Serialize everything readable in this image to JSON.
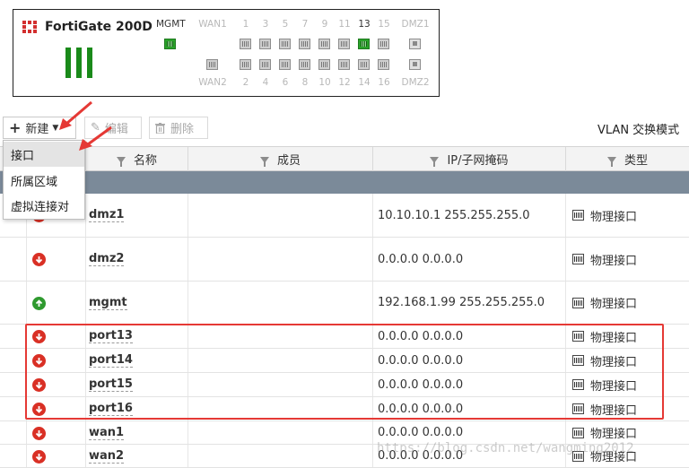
{
  "device": {
    "model": "FortiGate 200D",
    "top_labels": [
      "MGMT",
      "WAN1",
      "1",
      "3",
      "5",
      "7",
      "9",
      "11",
      "13",
      "15",
      "DMZ1"
    ],
    "bottom_labels": [
      "WAN2",
      "2",
      "4",
      "6",
      "8",
      "10",
      "12",
      "14",
      "16",
      "DMZ2"
    ],
    "active_labels": [
      "MGMT",
      "13"
    ]
  },
  "toolbar": {
    "create_label": "新建",
    "edit_label": "编辑",
    "delete_label": "删除",
    "vlan_mode_label": "VLAN 交换模式"
  },
  "create_menu": {
    "items": [
      "接口",
      "所属区域",
      "虚拟连接对"
    ]
  },
  "table": {
    "columns": [
      "名称",
      "成员",
      "IP/子网掩码",
      "类型"
    ],
    "rows": [
      {
        "name": "dmz1",
        "status": "down",
        "members": "",
        "ip": "10.10.10.1 255.255.255.0",
        "type": "物理接口"
      },
      {
        "name": "dmz2",
        "status": "down",
        "members": "",
        "ip": "0.0.0.0 0.0.0.0",
        "type": "物理接口"
      },
      {
        "name": "mgmt",
        "status": "up",
        "members": "",
        "ip": "192.168.1.99 255.255.255.0",
        "type": "物理接口"
      },
      {
        "name": "port13",
        "status": "down",
        "members": "",
        "ip": "0.0.0.0 0.0.0.0",
        "type": "物理接口"
      },
      {
        "name": "port14",
        "status": "down",
        "members": "",
        "ip": "0.0.0.0 0.0.0.0",
        "type": "物理接口"
      },
      {
        "name": "port15",
        "status": "down",
        "members": "",
        "ip": "0.0.0.0 0.0.0.0",
        "type": "物理接口"
      },
      {
        "name": "port16",
        "status": "down",
        "members": "",
        "ip": "0.0.0.0 0.0.0.0",
        "type": "物理接口"
      },
      {
        "name": "wan1",
        "status": "down",
        "members": "",
        "ip": "0.0.0.0 0.0.0.0",
        "type": "物理接口"
      },
      {
        "name": "wan2",
        "status": "down",
        "members": "",
        "ip": "0.0.0.0 0.0.0.0",
        "type": "物理接口"
      }
    ]
  },
  "watermark": "https://blog.csdn.net/wangming2012",
  "colors": {
    "status_up": "#2f9a2f",
    "status_down": "#d93025",
    "group_band": "#7b8a99",
    "annotation": "#e53935"
  }
}
